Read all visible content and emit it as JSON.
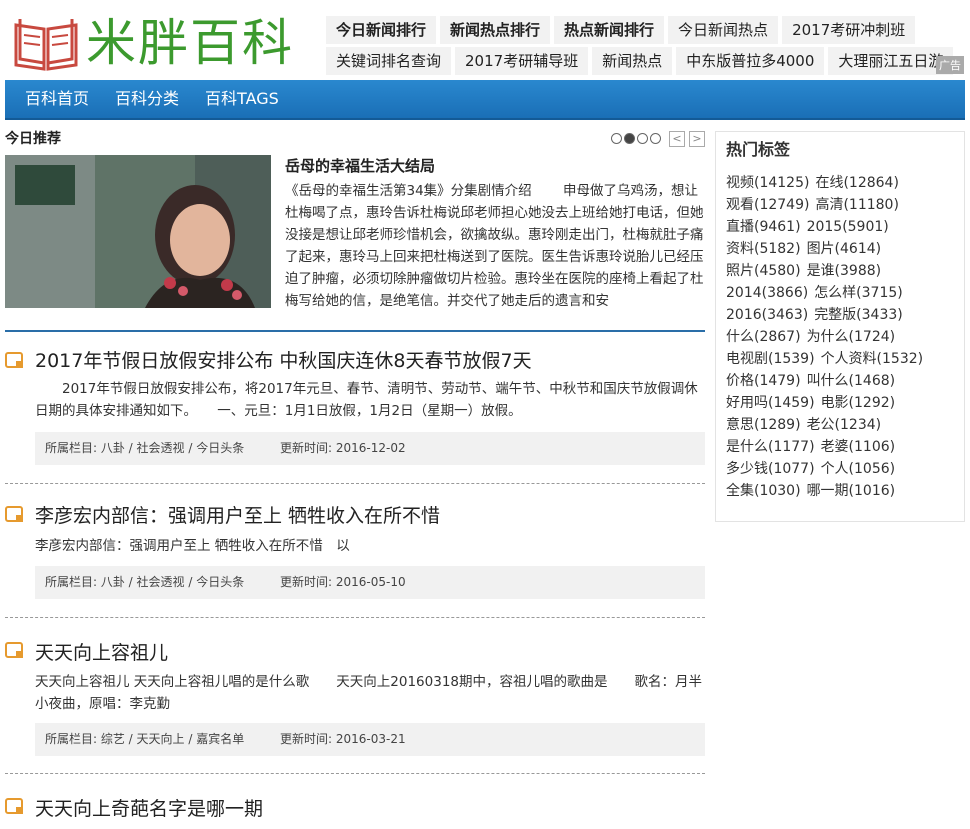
{
  "site": {
    "name": "米胖百科"
  },
  "header": {
    "links_row1": [
      {
        "label": "今日新闻排行",
        "bold": true
      },
      {
        "label": "新闻热点排行",
        "bold": true
      },
      {
        "label": "热点新闻排行",
        "bold": true
      },
      {
        "label": "今日新闻热点",
        "bold": false
      },
      {
        "label": "2017考研冲刺班",
        "bold": false
      }
    ],
    "links_row2": [
      {
        "label": "关键词排名查询"
      },
      {
        "label": "2017考研辅导班"
      },
      {
        "label": "新闻热点"
      },
      {
        "label": "中东版普拉多4000"
      },
      {
        "label": "大理丽江五日游"
      }
    ],
    "ad_badge": "广告"
  },
  "nav": {
    "items": [
      "百科首页",
      "百科分类",
      "百科TAGS"
    ]
  },
  "featured": {
    "section_title": "今日推荐",
    "arrow_prev": "<",
    "arrow_next": ">",
    "article_title": "岳母的幸福生活大结局",
    "article_text": "《岳母的幸福生活第34集》分集剧情介绍 　　申母做了乌鸡汤，想让杜梅喝了点，惠玲告诉杜梅说邱老师担心她没去上班给她打电话，但她没接是想让邱老师珍惜机会，欲擒故纵。惠玲刚走出门，杜梅就肚子痛了起来，惠玲马上回来把杜梅送到了医院。医生告诉惠玲说胎儿已经压迫了肿瘤，必须切除肿瘤做切片检验。惠玲坐在医院的座椅上看起了杜梅写给她的信，是绝笔信。并交代了她走后的遗言和安"
  },
  "articles": [
    {
      "title": "2017年节假日放假安排公布 中秋国庆连休8天春节放假7天",
      "summary": "　　2017年节假日放假安排公布，将2017年元旦、春节、清明节、劳动节、端午节、中秋节和国庆节放假调休日期的具体安排通知如下。　　一、元旦：1月1日放假，1月2日（星期一）放假。",
      "category": "所属栏目: 八卦 / 社会透视 / 今日头条",
      "updated": "更新时间: 2016-12-02"
    },
    {
      "title": "李彦宏内部信：强调用户至上 牺牲收入在所不惜",
      "summary": "李彦宏内部信：强调用户至上 牺牲收入在所不惜　以",
      "category": "所属栏目: 八卦 / 社会透视 / 今日头条",
      "updated": "更新时间: 2016-05-10"
    },
    {
      "title": "天天向上容祖儿",
      "summary": "天天向上容祖儿 天天向上容祖儿唱的是什么歌　　天天向上20160318期中，容祖儿唱的歌曲是　　歌名：月半小夜曲，原唱：李克勤",
      "category": "所属栏目: 综艺 / 天天向上 / 嘉宾名单",
      "updated": "更新时间: 2016-03-21"
    },
    {
      "title": "天天向上奇葩名字是哪一期"
    }
  ],
  "sidebar": {
    "title": "热门标签",
    "tags": [
      "视频(14125)",
      "在线(12864)",
      "观看(12749)",
      "高清(11180)",
      "直播(9461)",
      "2015(5901)",
      "资料(5182)",
      "图片(4614)",
      "照片(4580)",
      "是谁(3988)",
      "2014(3866)",
      "怎么样(3715)",
      "2016(3463)",
      "完整版(3433)",
      "什么(2867)",
      "为什么(1724)",
      "电视剧(1539)",
      "个人资料(1532)",
      "价格(1479)",
      "叫什么(1468)",
      "好用吗(1459)",
      "电影(1292)",
      "意思(1289)",
      "老公(1234)",
      "是什么(1177)",
      "老婆(1106)",
      "多少钱(1077)",
      "个人(1056)",
      "全集(1030)",
      "哪一期(1016)"
    ]
  },
  "colors": {
    "logo_green": "#3c9a2e",
    "logo_red": "#c8493f",
    "nav_blue": "#1f7cc4",
    "icon_orange": "#e69a2e"
  }
}
